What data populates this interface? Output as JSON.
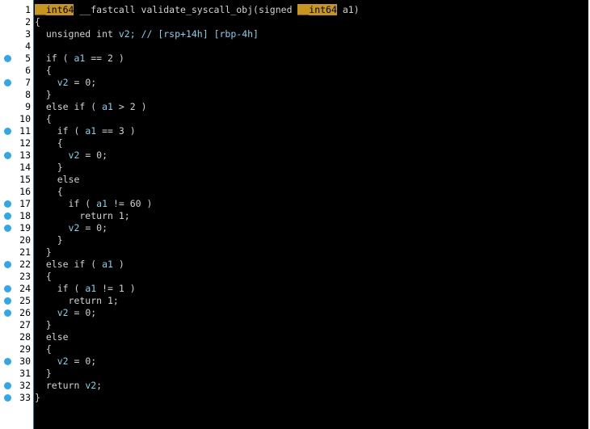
{
  "editor": {
    "lines": [
      {
        "no": "1",
        "bp": false,
        "parts": [
          {
            "t": "__int64",
            "c": "kw-type"
          },
          {
            "t": " __fastcall validate_syscall_obj(signed ",
            "c": "plain"
          },
          {
            "t": "__int64",
            "c": "kw-type"
          },
          {
            "t": " a1)",
            "c": "plain"
          }
        ]
      },
      {
        "no": "2",
        "bp": false,
        "parts": [
          {
            "t": "{",
            "c": "plain"
          }
        ]
      },
      {
        "no": "3",
        "bp": false,
        "parts": [
          {
            "t": "  unsigned int ",
            "c": "plain"
          },
          {
            "t": "v2",
            "c": "ident"
          },
          {
            "t": "; // [rsp+14h] [rbp-4h]",
            "c": "comment"
          }
        ]
      },
      {
        "no": "4",
        "bp": false,
        "parts": [
          {
            "t": "",
            "c": "plain"
          }
        ]
      },
      {
        "no": "5",
        "bp": true,
        "parts": [
          {
            "t": "  if ( ",
            "c": "plain"
          },
          {
            "t": "a1",
            "c": "ident"
          },
          {
            "t": " == 2 )",
            "c": "plain"
          }
        ]
      },
      {
        "no": "6",
        "bp": false,
        "parts": [
          {
            "t": "  {",
            "c": "plain"
          }
        ]
      },
      {
        "no": "7",
        "bp": true,
        "parts": [
          {
            "t": "    ",
            "c": "plain"
          },
          {
            "t": "v2",
            "c": "ident"
          },
          {
            "t": " = 0;",
            "c": "plain"
          }
        ]
      },
      {
        "no": "8",
        "bp": false,
        "parts": [
          {
            "t": "  }",
            "c": "plain"
          }
        ]
      },
      {
        "no": "9",
        "bp": false,
        "parts": [
          {
            "t": "  else if ( ",
            "c": "plain"
          },
          {
            "t": "a1",
            "c": "ident"
          },
          {
            "t": " > 2 )",
            "c": "plain"
          }
        ]
      },
      {
        "no": "10",
        "bp": false,
        "parts": [
          {
            "t": "  {",
            "c": "plain"
          }
        ]
      },
      {
        "no": "11",
        "bp": true,
        "parts": [
          {
            "t": "    if ( ",
            "c": "plain"
          },
          {
            "t": "a1",
            "c": "ident"
          },
          {
            "t": " == 3 )",
            "c": "plain"
          }
        ]
      },
      {
        "no": "12",
        "bp": false,
        "parts": [
          {
            "t": "    {",
            "c": "plain"
          }
        ]
      },
      {
        "no": "13",
        "bp": true,
        "parts": [
          {
            "t": "      ",
            "c": "plain"
          },
          {
            "t": "v2",
            "c": "ident"
          },
          {
            "t": " = 0;",
            "c": "plain"
          }
        ]
      },
      {
        "no": "14",
        "bp": false,
        "parts": [
          {
            "t": "    }",
            "c": "plain"
          }
        ]
      },
      {
        "no": "15",
        "bp": false,
        "parts": [
          {
            "t": "    else",
            "c": "plain"
          }
        ]
      },
      {
        "no": "16",
        "bp": false,
        "parts": [
          {
            "t": "    {",
            "c": "plain"
          }
        ]
      },
      {
        "no": "17",
        "bp": true,
        "parts": [
          {
            "t": "      if ( ",
            "c": "plain"
          },
          {
            "t": "a1",
            "c": "ident"
          },
          {
            "t": " != 60 )",
            "c": "plain"
          }
        ]
      },
      {
        "no": "18",
        "bp": true,
        "parts": [
          {
            "t": "        return 1;",
            "c": "plain"
          }
        ]
      },
      {
        "no": "19",
        "bp": true,
        "parts": [
          {
            "t": "      ",
            "c": "plain"
          },
          {
            "t": "v2",
            "c": "ident"
          },
          {
            "t": " = 0;",
            "c": "plain"
          }
        ]
      },
      {
        "no": "20",
        "bp": false,
        "parts": [
          {
            "t": "    }",
            "c": "plain"
          }
        ]
      },
      {
        "no": "21",
        "bp": false,
        "parts": [
          {
            "t": "  }",
            "c": "plain"
          }
        ]
      },
      {
        "no": "22",
        "bp": true,
        "parts": [
          {
            "t": "  else if ( ",
            "c": "plain"
          },
          {
            "t": "a1",
            "c": "ident"
          },
          {
            "t": " )",
            "c": "plain"
          }
        ]
      },
      {
        "no": "23",
        "bp": false,
        "parts": [
          {
            "t": "  {",
            "c": "plain"
          }
        ]
      },
      {
        "no": "24",
        "bp": true,
        "parts": [
          {
            "t": "    if ( ",
            "c": "plain"
          },
          {
            "t": "a1",
            "c": "ident"
          },
          {
            "t": " != 1 )",
            "c": "plain"
          }
        ]
      },
      {
        "no": "25",
        "bp": true,
        "parts": [
          {
            "t": "      return 1;",
            "c": "plain"
          }
        ]
      },
      {
        "no": "26",
        "bp": true,
        "parts": [
          {
            "t": "    ",
            "c": "plain"
          },
          {
            "t": "v2",
            "c": "ident"
          },
          {
            "t": " = 0;",
            "c": "plain"
          }
        ]
      },
      {
        "no": "27",
        "bp": false,
        "parts": [
          {
            "t": "  }",
            "c": "plain"
          }
        ]
      },
      {
        "no": "28",
        "bp": false,
        "parts": [
          {
            "t": "  else",
            "c": "plain"
          }
        ]
      },
      {
        "no": "29",
        "bp": false,
        "parts": [
          {
            "t": "  {",
            "c": "plain"
          }
        ]
      },
      {
        "no": "30",
        "bp": true,
        "parts": [
          {
            "t": "    ",
            "c": "plain"
          },
          {
            "t": "v2",
            "c": "ident"
          },
          {
            "t": " = 0;",
            "c": "plain"
          }
        ]
      },
      {
        "no": "31",
        "bp": false,
        "parts": [
          {
            "t": "  }",
            "c": "plain"
          }
        ]
      },
      {
        "no": "32",
        "bp": true,
        "parts": [
          {
            "t": "  return ",
            "c": "plain"
          },
          {
            "t": "v2",
            "c": "ident"
          },
          {
            "t": ";",
            "c": "plain"
          }
        ]
      },
      {
        "no": "33",
        "bp": true,
        "parts": [
          {
            "t": "}",
            "c": "plain"
          }
        ]
      }
    ]
  },
  "colors": {
    "background": "#000000",
    "gutter": "#ffffff",
    "keyword_highlight": "#c8961d",
    "identifier": "#82d2ee",
    "breakpoint": "#2ea8ea"
  },
  "icons": {
    "breakpoint": "breakpoint-dot-icon"
  }
}
